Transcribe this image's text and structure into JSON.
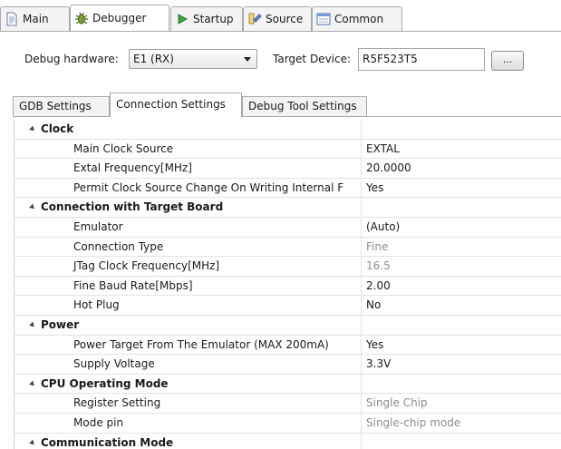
{
  "tabs": [
    {
      "label": "Main",
      "icon": "document-icon"
    },
    {
      "label": "Debugger",
      "icon": "debugger-icon"
    },
    {
      "label": "Startup",
      "icon": "play-icon"
    },
    {
      "label": "Source",
      "icon": "source-icon"
    },
    {
      "label": "Common",
      "icon": "common-icon"
    }
  ],
  "active_tab": "Debugger",
  "debug_hardware": {
    "label": "Debug hardware:",
    "value": "E1 (RX)"
  },
  "target_device": {
    "label": "Target Device:",
    "value": "R5F523T5",
    "browse_label": "..."
  },
  "inner_tabs": [
    "GDB Settings",
    "Connection Settings",
    "Debug Tool Settings"
  ],
  "active_inner_tab": "Connection Settings",
  "properties": [
    {
      "type": "category",
      "name": "Clock"
    },
    {
      "type": "prop",
      "name": "Main Clock Source",
      "value": "EXTAL",
      "dim": false
    },
    {
      "type": "prop",
      "name": "Extal Frequency[MHz]",
      "value": "20.0000",
      "dim": false
    },
    {
      "type": "prop",
      "name": "Permit Clock Source Change On Writing Internal F",
      "value": "Yes",
      "dim": false
    },
    {
      "type": "category",
      "name": "Connection with Target Board"
    },
    {
      "type": "prop",
      "name": "Emulator",
      "value": "(Auto)",
      "dim": false
    },
    {
      "type": "prop",
      "name": "Connection Type",
      "value": "Fine",
      "dim": true
    },
    {
      "type": "prop",
      "name": "JTag Clock Frequency[MHz]",
      "value": "16.5",
      "dim": true
    },
    {
      "type": "prop",
      "name": "Fine Baud Rate[Mbps]",
      "value": "2.00",
      "dim": false
    },
    {
      "type": "prop",
      "name": "Hot Plug",
      "value": "No",
      "dim": false
    },
    {
      "type": "category",
      "name": "Power"
    },
    {
      "type": "prop",
      "name": "Power Target From The Emulator (MAX 200mA)",
      "value": "Yes",
      "dim": false
    },
    {
      "type": "prop",
      "name": "Supply Voltage",
      "value": "3.3V",
      "dim": false
    },
    {
      "type": "category",
      "name": "CPU Operating Mode"
    },
    {
      "type": "prop",
      "name": "Register Setting",
      "value": "Single Chip",
      "dim": true
    },
    {
      "type": "prop",
      "name": "Mode pin",
      "value": "Single-chip mode",
      "dim": true
    },
    {
      "type": "category",
      "name": "Communication Mode"
    }
  ]
}
